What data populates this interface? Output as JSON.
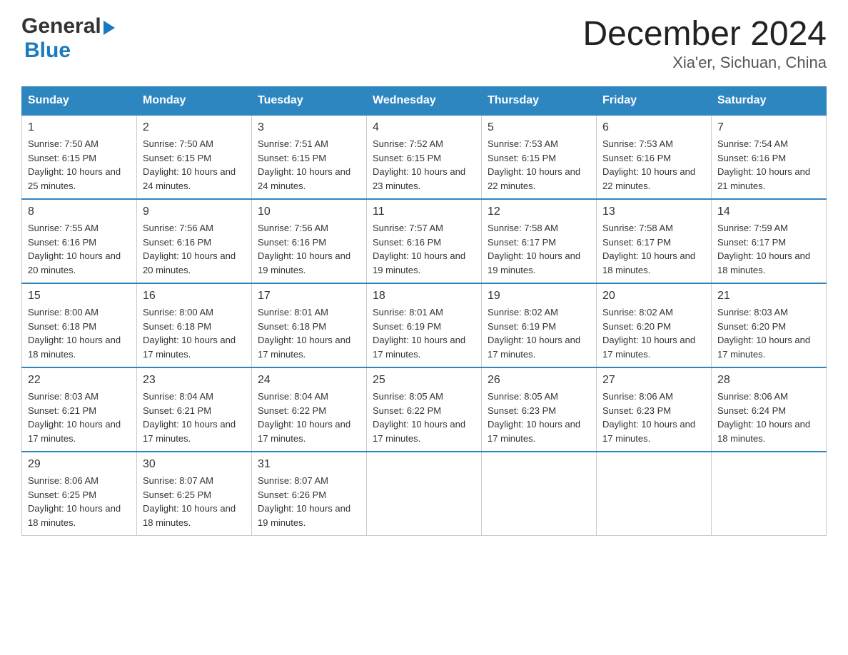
{
  "header": {
    "logo_general": "General",
    "logo_blue": "Blue",
    "title": "December 2024",
    "subtitle": "Xia'er, Sichuan, China"
  },
  "calendar": {
    "days_of_week": [
      "Sunday",
      "Monday",
      "Tuesday",
      "Wednesday",
      "Thursday",
      "Friday",
      "Saturday"
    ],
    "weeks": [
      [
        {
          "day": "1",
          "sunrise": "7:50 AM",
          "sunset": "6:15 PM",
          "daylight": "10 hours and 25 minutes."
        },
        {
          "day": "2",
          "sunrise": "7:50 AM",
          "sunset": "6:15 PM",
          "daylight": "10 hours and 24 minutes."
        },
        {
          "day": "3",
          "sunrise": "7:51 AM",
          "sunset": "6:15 PM",
          "daylight": "10 hours and 24 minutes."
        },
        {
          "day": "4",
          "sunrise": "7:52 AM",
          "sunset": "6:15 PM",
          "daylight": "10 hours and 23 minutes."
        },
        {
          "day": "5",
          "sunrise": "7:53 AM",
          "sunset": "6:15 PM",
          "daylight": "10 hours and 22 minutes."
        },
        {
          "day": "6",
          "sunrise": "7:53 AM",
          "sunset": "6:16 PM",
          "daylight": "10 hours and 22 minutes."
        },
        {
          "day": "7",
          "sunrise": "7:54 AM",
          "sunset": "6:16 PM",
          "daylight": "10 hours and 21 minutes."
        }
      ],
      [
        {
          "day": "8",
          "sunrise": "7:55 AM",
          "sunset": "6:16 PM",
          "daylight": "10 hours and 20 minutes."
        },
        {
          "day": "9",
          "sunrise": "7:56 AM",
          "sunset": "6:16 PM",
          "daylight": "10 hours and 20 minutes."
        },
        {
          "day": "10",
          "sunrise": "7:56 AM",
          "sunset": "6:16 PM",
          "daylight": "10 hours and 19 minutes."
        },
        {
          "day": "11",
          "sunrise": "7:57 AM",
          "sunset": "6:16 PM",
          "daylight": "10 hours and 19 minutes."
        },
        {
          "day": "12",
          "sunrise": "7:58 AM",
          "sunset": "6:17 PM",
          "daylight": "10 hours and 19 minutes."
        },
        {
          "day": "13",
          "sunrise": "7:58 AM",
          "sunset": "6:17 PM",
          "daylight": "10 hours and 18 minutes."
        },
        {
          "day": "14",
          "sunrise": "7:59 AM",
          "sunset": "6:17 PM",
          "daylight": "10 hours and 18 minutes."
        }
      ],
      [
        {
          "day": "15",
          "sunrise": "8:00 AM",
          "sunset": "6:18 PM",
          "daylight": "10 hours and 18 minutes."
        },
        {
          "day": "16",
          "sunrise": "8:00 AM",
          "sunset": "6:18 PM",
          "daylight": "10 hours and 17 minutes."
        },
        {
          "day": "17",
          "sunrise": "8:01 AM",
          "sunset": "6:18 PM",
          "daylight": "10 hours and 17 minutes."
        },
        {
          "day": "18",
          "sunrise": "8:01 AM",
          "sunset": "6:19 PM",
          "daylight": "10 hours and 17 minutes."
        },
        {
          "day": "19",
          "sunrise": "8:02 AM",
          "sunset": "6:19 PM",
          "daylight": "10 hours and 17 minutes."
        },
        {
          "day": "20",
          "sunrise": "8:02 AM",
          "sunset": "6:20 PM",
          "daylight": "10 hours and 17 minutes."
        },
        {
          "day": "21",
          "sunrise": "8:03 AM",
          "sunset": "6:20 PM",
          "daylight": "10 hours and 17 minutes."
        }
      ],
      [
        {
          "day": "22",
          "sunrise": "8:03 AM",
          "sunset": "6:21 PM",
          "daylight": "10 hours and 17 minutes."
        },
        {
          "day": "23",
          "sunrise": "8:04 AM",
          "sunset": "6:21 PM",
          "daylight": "10 hours and 17 minutes."
        },
        {
          "day": "24",
          "sunrise": "8:04 AM",
          "sunset": "6:22 PM",
          "daylight": "10 hours and 17 minutes."
        },
        {
          "day": "25",
          "sunrise": "8:05 AM",
          "sunset": "6:22 PM",
          "daylight": "10 hours and 17 minutes."
        },
        {
          "day": "26",
          "sunrise": "8:05 AM",
          "sunset": "6:23 PM",
          "daylight": "10 hours and 17 minutes."
        },
        {
          "day": "27",
          "sunrise": "8:06 AM",
          "sunset": "6:23 PM",
          "daylight": "10 hours and 17 minutes."
        },
        {
          "day": "28",
          "sunrise": "8:06 AM",
          "sunset": "6:24 PM",
          "daylight": "10 hours and 18 minutes."
        }
      ],
      [
        {
          "day": "29",
          "sunrise": "8:06 AM",
          "sunset": "6:25 PM",
          "daylight": "10 hours and 18 minutes."
        },
        {
          "day": "30",
          "sunrise": "8:07 AM",
          "sunset": "6:25 PM",
          "daylight": "10 hours and 18 minutes."
        },
        {
          "day": "31",
          "sunrise": "8:07 AM",
          "sunset": "6:26 PM",
          "daylight": "10 hours and 19 minutes."
        },
        null,
        null,
        null,
        null
      ]
    ]
  }
}
